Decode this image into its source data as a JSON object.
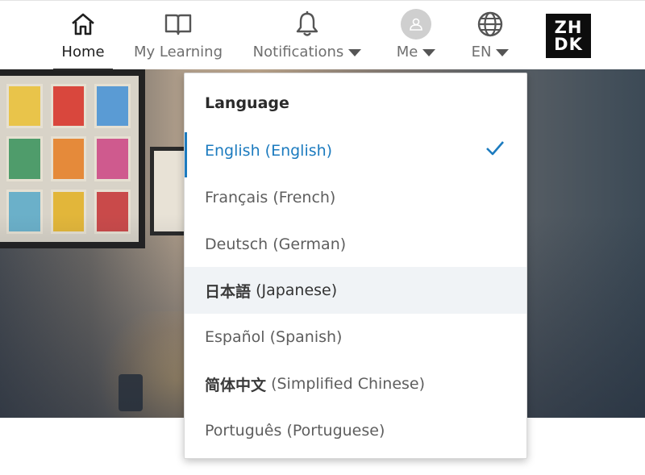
{
  "nav": {
    "items": [
      {
        "label": "Home",
        "icon": "home-icon",
        "active": true
      },
      {
        "label": "My Learning",
        "icon": "book-icon"
      },
      {
        "label": "Notifications",
        "icon": "bell-icon",
        "has_caret": true
      },
      {
        "label": "Me",
        "icon": "avatar",
        "has_caret": true
      },
      {
        "label": "EN",
        "icon": "globe-icon",
        "has_caret": true
      }
    ],
    "logo": {
      "line1": "ZH",
      "line2": "DK"
    }
  },
  "language_menu": {
    "title": "Language",
    "selected_index": 0,
    "hovered_index": 3,
    "options": [
      {
        "native": "English",
        "english": "(English)"
      },
      {
        "native": "Français",
        "english": "(French)"
      },
      {
        "native": "Deutsch",
        "english": "(German)"
      },
      {
        "native": "日本語",
        "english": "(Japanese)"
      },
      {
        "native": "Español",
        "english": "(Spanish)"
      },
      {
        "native": "简体中文",
        "english": "(Simplified Chinese)"
      },
      {
        "native": "Português",
        "english": "(Portuguese)"
      }
    ]
  },
  "colors": {
    "accent": "#1c7bbf",
    "nav_text": "#6f6f6f",
    "hover_bg": "#f0f3f6"
  }
}
